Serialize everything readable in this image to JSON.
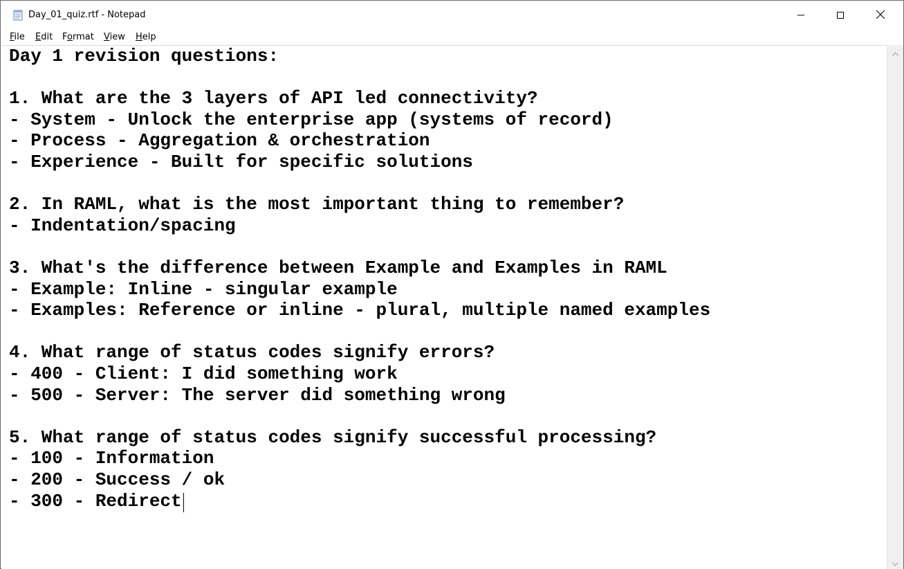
{
  "window": {
    "title": "Day_01_quiz.rtf - Notepad",
    "icon": "notepad-icon"
  },
  "controls": {
    "minimize_icon": "minimize-icon",
    "maximize_icon": "maximize-icon",
    "close_icon": "close-icon"
  },
  "menu": {
    "file": {
      "key": "F",
      "rest": "ile"
    },
    "edit": {
      "key": "E",
      "rest": "dit"
    },
    "format": {
      "pre": "F",
      "key": "o",
      "rest": "rmat"
    },
    "view": {
      "key": "V",
      "rest": "iew"
    },
    "help": {
      "key": "H",
      "rest": "elp"
    }
  },
  "document": {
    "lines": [
      "Day 1 revision questions:",
      "",
      "1. What are the 3 layers of API led connectivity?",
      "- System - Unlock the enterprise app (systems of record)",
      "- Process - Aggregation & orchestration",
      "- Experience - Built for specific solutions",
      "",
      "2. In RAML, what is the most important thing to remember?",
      "- Indentation/spacing",
      "",
      "3. What's the difference between Example and Examples in RAML",
      "- Example: Inline - singular example",
      "- Examples: Reference or inline - plural, multiple named examples",
      "",
      "4. What range of status codes signify errors?",
      "- 400 - Client: I did something work",
      "- 500 - Server: The server did something wrong",
      "",
      "5. What range of status codes signify successful processing?",
      "- 100 - Information",
      "- 200 - Success / ok",
      "- 300 - Redirect"
    ]
  }
}
